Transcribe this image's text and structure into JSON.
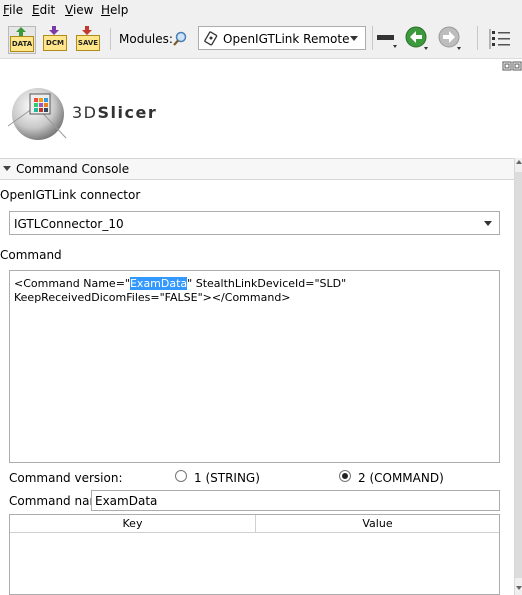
{
  "menu": {
    "items": [
      {
        "accel": "F",
        "rest": "ile"
      },
      {
        "accel": "E",
        "rest": "dit"
      },
      {
        "accel": "V",
        "rest": "iew"
      },
      {
        "accel": "H",
        "rest": "elp"
      }
    ]
  },
  "toolbar": {
    "data_label": "DATA",
    "dcm_label": "DCM",
    "save_label": "SAVE",
    "modules_label": "Modules:",
    "module_selected": "OpenIGTLink Remote",
    "icons": [
      "search-icon",
      "module-icon",
      "view-layout-icon",
      "back-arrow-icon",
      "forward-arrow-icon",
      "module-list-icon"
    ]
  },
  "logo": {
    "prefix": "3D",
    "name": "Slicer"
  },
  "panel": {
    "title": "Command Console",
    "connector_label": "OpenIGTLink connector",
    "connector_value": "IGTLConnector_10",
    "command_label": "Command",
    "command_text_before": "<Command Name=\"",
    "command_text_selected": "ExamData",
    "command_text_after": "\" StealthLinkDeviceId=\"SLD\" KeepReceivedDicomFiles=\"FALSE\"></Command>",
    "version_label": "Command version:",
    "version_options": [
      {
        "label": "1 (STRING)",
        "checked": false
      },
      {
        "label": "2 (COMMAND)",
        "checked": true
      }
    ],
    "name_label": "Command name:",
    "name_value": "ExamData",
    "table_headers": [
      "Key",
      "Value"
    ]
  },
  "colors": {
    "selection": "#3399ff",
    "toolbar_bg": "#f0f0f0",
    "nav_green": "#3c9a3c"
  }
}
